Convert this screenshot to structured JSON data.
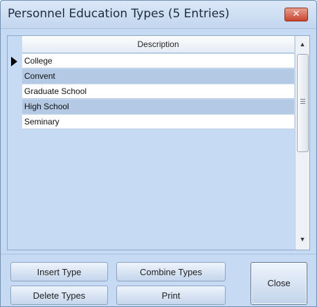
{
  "window": {
    "title": "Personnel Education Types (5 Entries)",
    "close_glyph": "✕"
  },
  "grid": {
    "column_header": "Description",
    "rows": [
      {
        "label": "College",
        "selected": true
      },
      {
        "label": "Convent",
        "selected": false
      },
      {
        "label": "Graduate School",
        "selected": false
      },
      {
        "label": "High School",
        "selected": false
      },
      {
        "label": "Seminary",
        "selected": false
      }
    ]
  },
  "scrollbar": {
    "up_glyph": "▲",
    "down_glyph": "▼"
  },
  "buttons": {
    "insert": "Insert Type",
    "combine": "Combine Types",
    "delete": "Delete Types",
    "print": "Print",
    "close": "Close"
  },
  "colors": {
    "window_bg": "#c6daf3",
    "row_alt": "#b3c9e4",
    "close_button": "#c9452f"
  }
}
